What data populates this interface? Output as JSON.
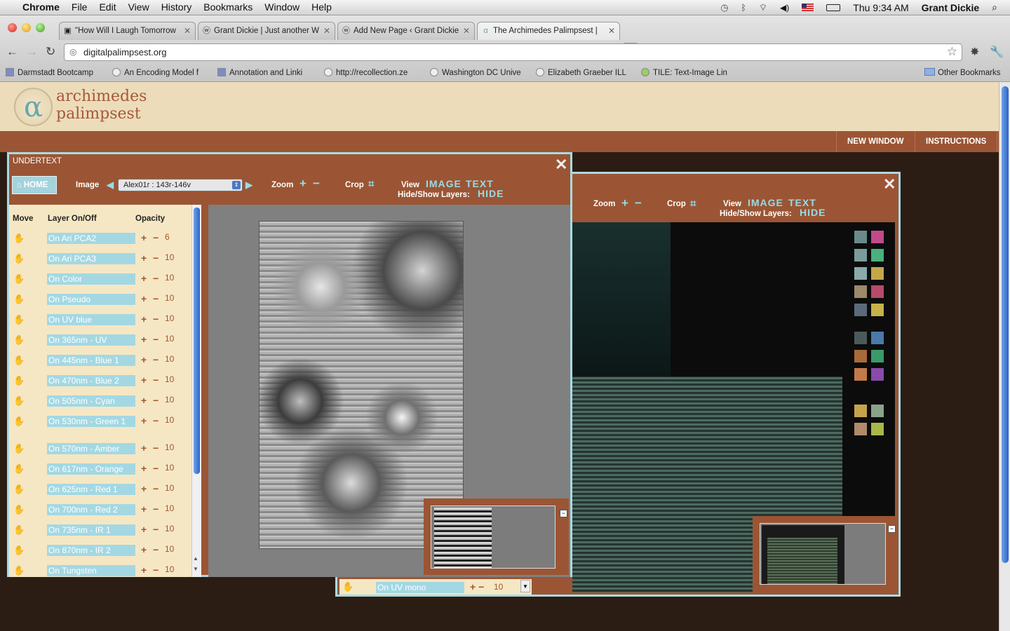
{
  "menubar": {
    "app": "Chrome",
    "items": [
      "File",
      "Edit",
      "View",
      "History",
      "Bookmarks",
      "Window",
      "Help"
    ],
    "clock": "Thu 9:34 AM",
    "user": "Grant Dickie"
  },
  "tabs": [
    {
      "label": "\"How Will I Laugh Tomorrow"
    },
    {
      "label": "Grant Dickie | Just another W"
    },
    {
      "label": "Add New Page ‹ Grant Dickie"
    },
    {
      "label": "The Archimedes Palimpsest |"
    }
  ],
  "address": "digitalpalimpsest.org",
  "bookmarks": [
    "Darmstadt Bootcamp",
    "An Encoding Model f",
    "Annotation and Linki",
    "http://recollection.ze",
    "Washington DC Unive",
    "Elizabeth Graeber ILL",
    "TILE: Text-Image Lin"
  ],
  "other_bookmarks": "Other Bookmarks",
  "site": {
    "logo_symbol": "α",
    "title_line1": "archimedes",
    "title_line2": "palimpsest",
    "nav": [
      "NEW WINDOW",
      "INSTRUCTIONS"
    ]
  },
  "panel1": {
    "title": "UNDERTEXT",
    "close": "✕",
    "home": "HOME",
    "image_label": "Image",
    "image_value": "Alex01r : 143r-146v",
    "zoom": "Zoom",
    "crop": "Crop",
    "view": "View",
    "view_image": "IMAGE",
    "view_text": "TEXT",
    "hide_show": "Hide/Show Layers:",
    "hide": "HIDE",
    "col_move": "Move",
    "col_layer": "Layer On/Off",
    "col_opacity": "Opacity",
    "layers": [
      {
        "label": "On Ari PCA2",
        "opacity": "6"
      },
      {
        "label": "On Ari PCA3",
        "opacity": "10"
      },
      {
        "label": "On Color",
        "opacity": "10"
      },
      {
        "label": "On Pseudo",
        "opacity": "10"
      },
      {
        "label": "On UV blue",
        "opacity": "10"
      },
      {
        "label": "On 365nm - UV",
        "opacity": "10"
      },
      {
        "label": "On 445nm - Blue 1",
        "opacity": "10"
      },
      {
        "label": "On 470nm - Blue 2",
        "opacity": "10"
      },
      {
        "label": "On 505nm - Cyan",
        "opacity": "10"
      },
      {
        "label": "On 530nm - Green 1",
        "opacity": "10"
      },
      {
        "label": "On 570nm - Amber",
        "opacity": "10"
      },
      {
        "label": "On 617nm - Orange",
        "opacity": "10"
      },
      {
        "label": "On 625nm - Red 1",
        "opacity": "10"
      },
      {
        "label": "On 700nm - Red 2",
        "opacity": "10"
      },
      {
        "label": "On 735nm - IR 1",
        "opacity": "10"
      },
      {
        "label": "On 870nm - IR 2",
        "opacity": "10"
      },
      {
        "label": "On Tungsten",
        "opacity": "10"
      }
    ]
  },
  "panel2": {
    "close": "✕",
    "zoom": "Zoom",
    "crop": "Crop",
    "view": "View",
    "view_image": "IMAGE",
    "view_text": "TEXT",
    "hide_show": "Hide/Show Layers:",
    "hide": "HIDE",
    "bottom_layer": "On UV mono",
    "bottom_opacity": "10"
  },
  "colors": {
    "brand_brown": "#9b5534",
    "header_cream": "#ecdcba",
    "accent_cyan": "#96dce8",
    "background": "#2c1d14"
  }
}
